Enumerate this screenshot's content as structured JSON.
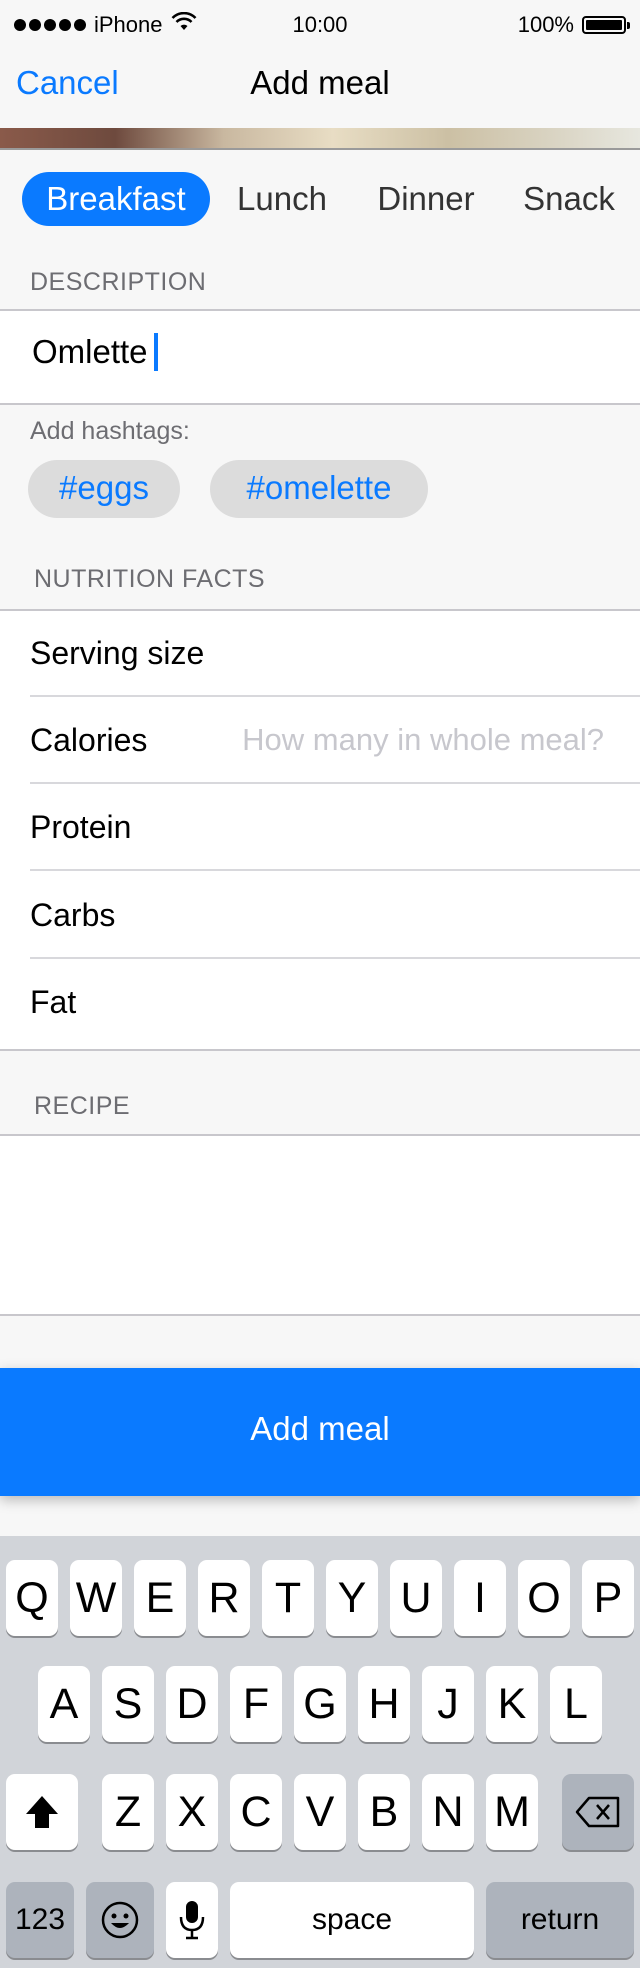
{
  "status_bar": {
    "carrier": "iPhone",
    "time": "10:00",
    "battery": "100%",
    "battery_level": 1.0
  },
  "nav": {
    "cancel_label": "Cancel",
    "title": "Add meal"
  },
  "meal_types": {
    "items": [
      "Breakfast",
      "Lunch",
      "Dinner",
      "Snack"
    ],
    "selected": "Breakfast"
  },
  "description": {
    "header": "DESCRIPTION",
    "value": "Omlette"
  },
  "hashtags": {
    "label": "Add hashtags:",
    "tags": [
      "#eggs",
      "#omelette"
    ]
  },
  "nutrition": {
    "header": "NUTRITION FACTS",
    "rows": [
      {
        "label": "Serving size",
        "placeholder": ""
      },
      {
        "label": "Calories",
        "placeholder": "How many in whole meal?"
      },
      {
        "label": "Protein",
        "placeholder": ""
      },
      {
        "label": "Carbs",
        "placeholder": ""
      },
      {
        "label": "Fat",
        "placeholder": ""
      }
    ]
  },
  "recipe": {
    "header": "RECIPE",
    "value": ""
  },
  "add_button_label": "Add meal",
  "keyboard": {
    "row1": [
      "Q",
      "W",
      "E",
      "R",
      "T",
      "Y",
      "U",
      "I",
      "O",
      "P"
    ],
    "row2": [
      "A",
      "S",
      "D",
      "F",
      "G",
      "H",
      "J",
      "K",
      "L"
    ],
    "row3": [
      "Z",
      "X",
      "C",
      "V",
      "B",
      "N",
      "M"
    ],
    "numbers_label": "123",
    "space_label": "space",
    "return_label": "return"
  },
  "colors": {
    "accent": "#0a7aff",
    "keyboard_bg": "#d1d4d9",
    "placeholder": "#c7c7cd"
  }
}
